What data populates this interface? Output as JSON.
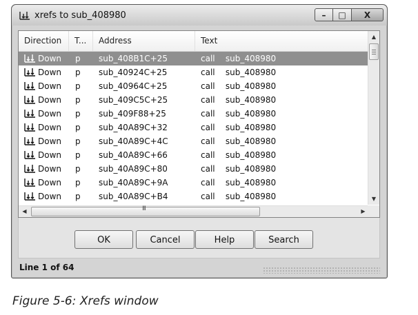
{
  "window": {
    "title": "xrefs to sub_408980",
    "icon": "xrefs-icon",
    "controls": {
      "minimize": "–",
      "maximize": "□",
      "close": "X"
    }
  },
  "columns": [
    "Direction",
    "T...",
    "Address",
    "Text"
  ],
  "rows": [
    {
      "direction": "Down",
      "type": "p",
      "address": "sub_408B1C+25",
      "text": "call    sub_408980",
      "selected": true
    },
    {
      "direction": "Down",
      "type": "p",
      "address": "sub_40924C+25",
      "text": "call    sub_408980"
    },
    {
      "direction": "Down",
      "type": "p",
      "address": "sub_40964C+25",
      "text": "call    sub_408980"
    },
    {
      "direction": "Down",
      "type": "p",
      "address": "sub_409C5C+25",
      "text": "call    sub_408980"
    },
    {
      "direction": "Down",
      "type": "p",
      "address": "sub_409F88+25",
      "text": "call    sub_408980"
    },
    {
      "direction": "Down",
      "type": "p",
      "address": "sub_40A89C+32",
      "text": "call    sub_408980"
    },
    {
      "direction": "Down",
      "type": "p",
      "address": "sub_40A89C+4C",
      "text": "call    sub_408980"
    },
    {
      "direction": "Down",
      "type": "p",
      "address": "sub_40A89C+66",
      "text": "call    sub_408980"
    },
    {
      "direction": "Down",
      "type": "p",
      "address": "sub_40A89C+80",
      "text": "call    sub_408980"
    },
    {
      "direction": "Down",
      "type": "p",
      "address": "sub_40A89C+9A",
      "text": "call    sub_408980"
    },
    {
      "direction": "Down",
      "type": "p",
      "address": "sub_40A89C+B4",
      "text": "call    sub_408980"
    }
  ],
  "scroll": {
    "h_grip": "III"
  },
  "buttons": {
    "ok": "OK",
    "cancel": "Cancel",
    "help": "Help",
    "search": "Search"
  },
  "status": {
    "line": "Line 1 of 64"
  },
  "caption": "Figure 5-6: Xrefs window"
}
